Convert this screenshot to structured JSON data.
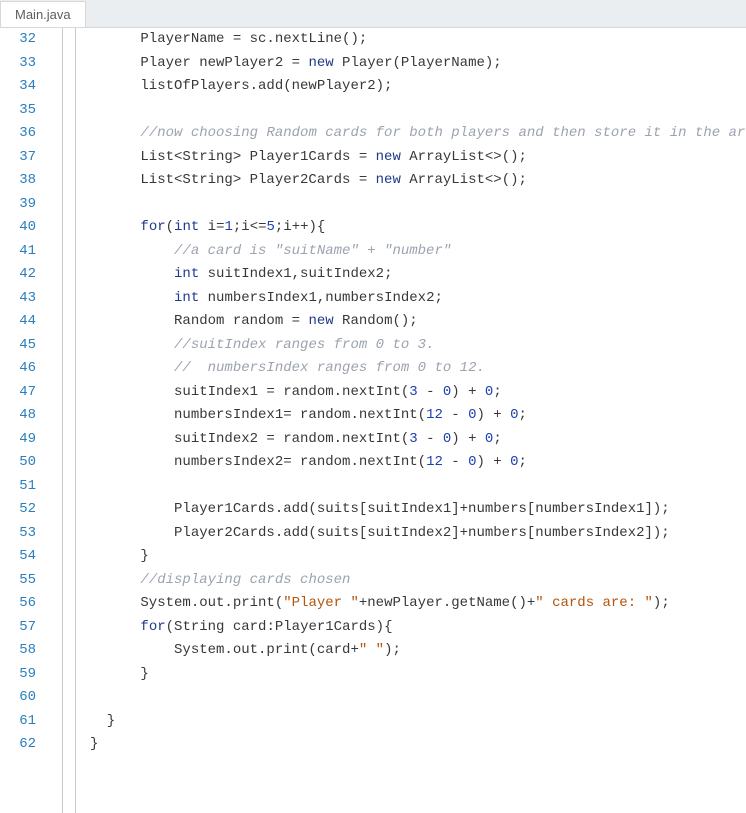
{
  "tab": {
    "filename": "Main.java"
  },
  "lines": [
    {
      "num": "32",
      "tokens": [
        {
          "t": "      PlayerName = sc.nextLine();",
          "c": ""
        }
      ]
    },
    {
      "num": "33",
      "tokens": [
        {
          "t": "      Player newPlayer2 = ",
          "c": ""
        },
        {
          "t": "new",
          "c": "kw"
        },
        {
          "t": " Player(PlayerName);",
          "c": ""
        }
      ]
    },
    {
      "num": "34",
      "tokens": [
        {
          "t": "      listOfPlayers.add(newPlayer2);",
          "c": ""
        }
      ]
    },
    {
      "num": "35",
      "tokens": [
        {
          "t": "",
          "c": ""
        }
      ]
    },
    {
      "num": "36",
      "tokens": [
        {
          "t": "      ",
          "c": ""
        },
        {
          "t": "//now choosing Random cards for both players and then store it in the array.",
          "c": "cmt"
        }
      ]
    },
    {
      "num": "37",
      "tokens": [
        {
          "t": "      List<String> Player1Cards = ",
          "c": ""
        },
        {
          "t": "new",
          "c": "kw"
        },
        {
          "t": " ArrayList<>();",
          "c": ""
        }
      ]
    },
    {
      "num": "38",
      "tokens": [
        {
          "t": "      List<String> Player2Cards = ",
          "c": ""
        },
        {
          "t": "new",
          "c": "kw"
        },
        {
          "t": " ArrayList<>();",
          "c": ""
        }
      ]
    },
    {
      "num": "39",
      "tokens": [
        {
          "t": "",
          "c": ""
        }
      ]
    },
    {
      "num": "40",
      "tokens": [
        {
          "t": "      ",
          "c": ""
        },
        {
          "t": "for",
          "c": "kw"
        },
        {
          "t": "(",
          "c": ""
        },
        {
          "t": "int",
          "c": "kw"
        },
        {
          "t": " i=",
          "c": ""
        },
        {
          "t": "1",
          "c": "num"
        },
        {
          "t": ";i<=",
          "c": ""
        },
        {
          "t": "5",
          "c": "num"
        },
        {
          "t": ";i++){",
          "c": ""
        }
      ]
    },
    {
      "num": "41",
      "tokens": [
        {
          "t": "          ",
          "c": ""
        },
        {
          "t": "//a card is \"suitName\" + \"number\"",
          "c": "cmt"
        }
      ]
    },
    {
      "num": "42",
      "tokens": [
        {
          "t": "          ",
          "c": ""
        },
        {
          "t": "int",
          "c": "kw"
        },
        {
          "t": " suitIndex1,suitIndex2;",
          "c": ""
        }
      ]
    },
    {
      "num": "43",
      "tokens": [
        {
          "t": "          ",
          "c": ""
        },
        {
          "t": "int",
          "c": "kw"
        },
        {
          "t": " numbersIndex1,numbersIndex2;",
          "c": ""
        }
      ]
    },
    {
      "num": "44",
      "tokens": [
        {
          "t": "          Random random = ",
          "c": ""
        },
        {
          "t": "new",
          "c": "kw"
        },
        {
          "t": " Random();",
          "c": ""
        }
      ]
    },
    {
      "num": "45",
      "tokens": [
        {
          "t": "          ",
          "c": ""
        },
        {
          "t": "//suitIndex ranges from 0 to 3.",
          "c": "cmt"
        }
      ]
    },
    {
      "num": "46",
      "tokens": [
        {
          "t": "          ",
          "c": ""
        },
        {
          "t": "//  numbersIndex ranges from 0 to 12.",
          "c": "cmt"
        }
      ]
    },
    {
      "num": "47",
      "tokens": [
        {
          "t": "          suitIndex1 = random.nextInt(",
          "c": ""
        },
        {
          "t": "3",
          "c": "num"
        },
        {
          "t": " - ",
          "c": ""
        },
        {
          "t": "0",
          "c": "num"
        },
        {
          "t": ") + ",
          "c": ""
        },
        {
          "t": "0",
          "c": "num"
        },
        {
          "t": ";",
          "c": ""
        }
      ]
    },
    {
      "num": "48",
      "tokens": [
        {
          "t": "          numbersIndex1= random.nextInt(",
          "c": ""
        },
        {
          "t": "12",
          "c": "num"
        },
        {
          "t": " - ",
          "c": ""
        },
        {
          "t": "0",
          "c": "num"
        },
        {
          "t": ") + ",
          "c": ""
        },
        {
          "t": "0",
          "c": "num"
        },
        {
          "t": ";",
          "c": ""
        }
      ]
    },
    {
      "num": "49",
      "tokens": [
        {
          "t": "          suitIndex2 = random.nextInt(",
          "c": ""
        },
        {
          "t": "3",
          "c": "num"
        },
        {
          "t": " - ",
          "c": ""
        },
        {
          "t": "0",
          "c": "num"
        },
        {
          "t": ") + ",
          "c": ""
        },
        {
          "t": "0",
          "c": "num"
        },
        {
          "t": ";",
          "c": ""
        }
      ]
    },
    {
      "num": "50",
      "tokens": [
        {
          "t": "          numbersIndex2= random.nextInt(",
          "c": ""
        },
        {
          "t": "12",
          "c": "num"
        },
        {
          "t": " - ",
          "c": ""
        },
        {
          "t": "0",
          "c": "num"
        },
        {
          "t": ") + ",
          "c": ""
        },
        {
          "t": "0",
          "c": "num"
        },
        {
          "t": ";",
          "c": ""
        }
      ]
    },
    {
      "num": "51",
      "tokens": [
        {
          "t": "",
          "c": ""
        }
      ]
    },
    {
      "num": "52",
      "tokens": [
        {
          "t": "          Player1Cards.add(suits[suitIndex1]+numbers[numbersIndex1]);",
          "c": ""
        }
      ]
    },
    {
      "num": "53",
      "tokens": [
        {
          "t": "          Player2Cards.add(suits[suitIndex2]+numbers[numbersIndex2]);",
          "c": ""
        }
      ]
    },
    {
      "num": "54",
      "tokens": [
        {
          "t": "      }",
          "c": ""
        }
      ]
    },
    {
      "num": "55",
      "tokens": [
        {
          "t": "      ",
          "c": ""
        },
        {
          "t": "//displaying cards chosen",
          "c": "cmt"
        }
      ]
    },
    {
      "num": "56",
      "tokens": [
        {
          "t": "      System.out.print(",
          "c": ""
        },
        {
          "t": "\"Player \"",
          "c": "str"
        },
        {
          "t": "+newPlayer.getName()+",
          "c": ""
        },
        {
          "t": "\" cards are: \"",
          "c": "str"
        },
        {
          "t": ");",
          "c": ""
        }
      ]
    },
    {
      "num": "57",
      "tokens": [
        {
          "t": "      ",
          "c": ""
        },
        {
          "t": "for",
          "c": "kw"
        },
        {
          "t": "(String card:Player1Cards){",
          "c": ""
        }
      ]
    },
    {
      "num": "58",
      "tokens": [
        {
          "t": "          System.out.print(card+",
          "c": ""
        },
        {
          "t": "\" \"",
          "c": "str"
        },
        {
          "t": ");",
          "c": ""
        }
      ]
    },
    {
      "num": "59",
      "tokens": [
        {
          "t": "      }",
          "c": ""
        }
      ]
    },
    {
      "num": "60",
      "tokens": [
        {
          "t": "",
          "c": ""
        }
      ]
    },
    {
      "num": "61",
      "tokens": [
        {
          "t": "  }",
          "c": ""
        }
      ]
    },
    {
      "num": "62",
      "tokens": [
        {
          "t": "}",
          "c": ""
        }
      ]
    }
  ]
}
